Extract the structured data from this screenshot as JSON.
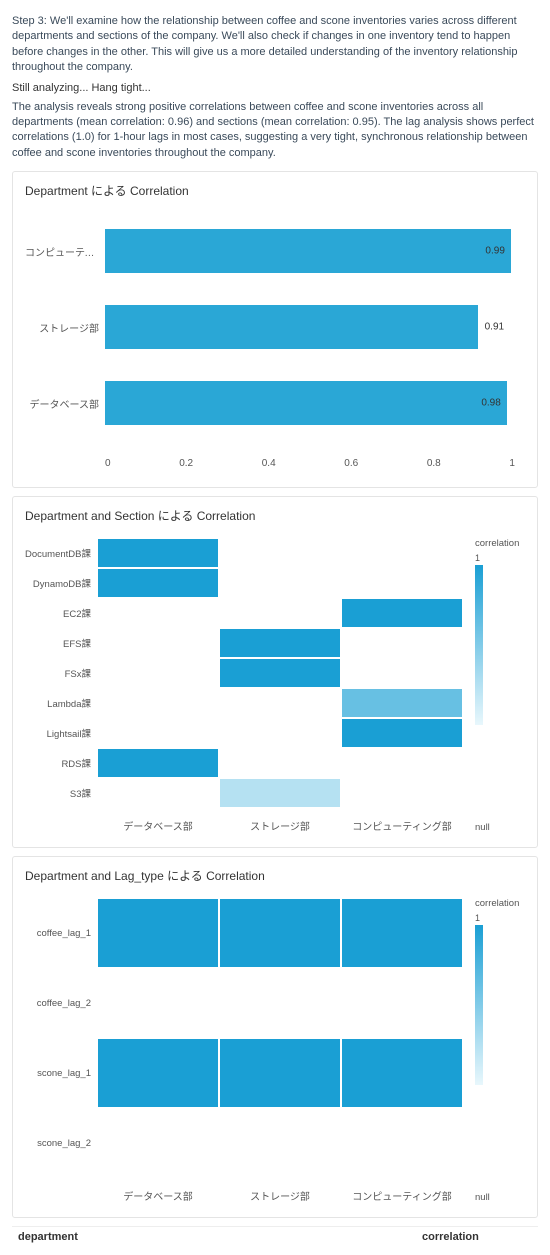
{
  "dim_row": "",
  "step3": "Step 3: We'll examine how the relationship between coffee and scone inventories varies across different departments and sections of the company. We'll also check if changes in one inventory tend to happen before changes in the other. This will give us a more detailed understanding of the inventory relationship throughout the company.",
  "analyzing": "Still analyzing... Hang tight...",
  "result": "The analysis reveals strong positive correlations between coffee and scone inventories across all departments (mean correlation: 0.96) and sections (mean correlation: 0.95). The lag analysis shows perfect correlations (1.0) for 1-hour lags in most cases, suggesting a very tight, synchronous relationship between coffee and scone inventories throughout the company.",
  "chart1": {
    "title": "Department による Correlation"
  },
  "chart2": {
    "title": "Department and Section による Correlation",
    "legend": "correlation",
    "legend_max": "1",
    "legend_min": "null"
  },
  "chart3": {
    "title": "Department and Lag_type による Correlation",
    "legend": "correlation",
    "legend_max": "1",
    "legend_min": "null"
  },
  "x_ticks": {
    "t0": "0",
    "t1": "0.2",
    "t2": "0.4",
    "t3": "0.6",
    "t4": "0.8",
    "t5": "1"
  },
  "departments": {
    "d0": "データベース部",
    "d1": "ストレージ部",
    "d2": "コンピューティング部"
  },
  "table": {
    "col1": "department",
    "col2": "correlation"
  },
  "chart_data": [
    {
      "type": "bar",
      "title": "Department による Correlation",
      "orientation": "horizontal",
      "categories": [
        "コンピューティン...",
        "ストレージ部",
        "データベース部"
      ],
      "values": [
        0.99,
        0.91,
        0.98
      ],
      "xlim": [
        0,
        1
      ],
      "xticks": [
        0,
        0.2,
        0.4,
        0.6,
        0.8,
        1
      ]
    },
    {
      "type": "heatmap",
      "title": "Department and Section による Correlation",
      "x_categories": [
        "データベース部",
        "ストレージ部",
        "コンピューティング部"
      ],
      "y_categories": [
        "DocumentDB課",
        "DynamoDB課",
        "EC2課",
        "EFS課",
        "FSx課",
        "Lambda課",
        "Lightsail課",
        "RDS課",
        "S3課"
      ],
      "values": [
        [
          1.0,
          null,
          null
        ],
        [
          1.0,
          null,
          null
        ],
        [
          null,
          null,
          1.0
        ],
        [
          null,
          1.0,
          null
        ],
        [
          null,
          1.0,
          null
        ],
        [
          null,
          null,
          0.85
        ],
        [
          null,
          null,
          1.0
        ],
        [
          1.0,
          null,
          null
        ],
        [
          null,
          0.7,
          null
        ]
      ],
      "colorscale": {
        "min": "null",
        "max": 1
      }
    },
    {
      "type": "heatmap",
      "title": "Department and Lag_type による Correlation",
      "x_categories": [
        "データベース部",
        "ストレージ部",
        "コンピューティング部"
      ],
      "y_categories": [
        "coffee_lag_1",
        "coffee_lag_2",
        "scone_lag_1",
        "scone_lag_2"
      ],
      "values": [
        [
          1.0,
          1.0,
          1.0
        ],
        [
          null,
          null,
          null
        ],
        [
          1.0,
          1.0,
          1.0
        ],
        [
          null,
          null,
          null
        ]
      ],
      "colorscale": {
        "min": "null",
        "max": 1
      }
    }
  ]
}
